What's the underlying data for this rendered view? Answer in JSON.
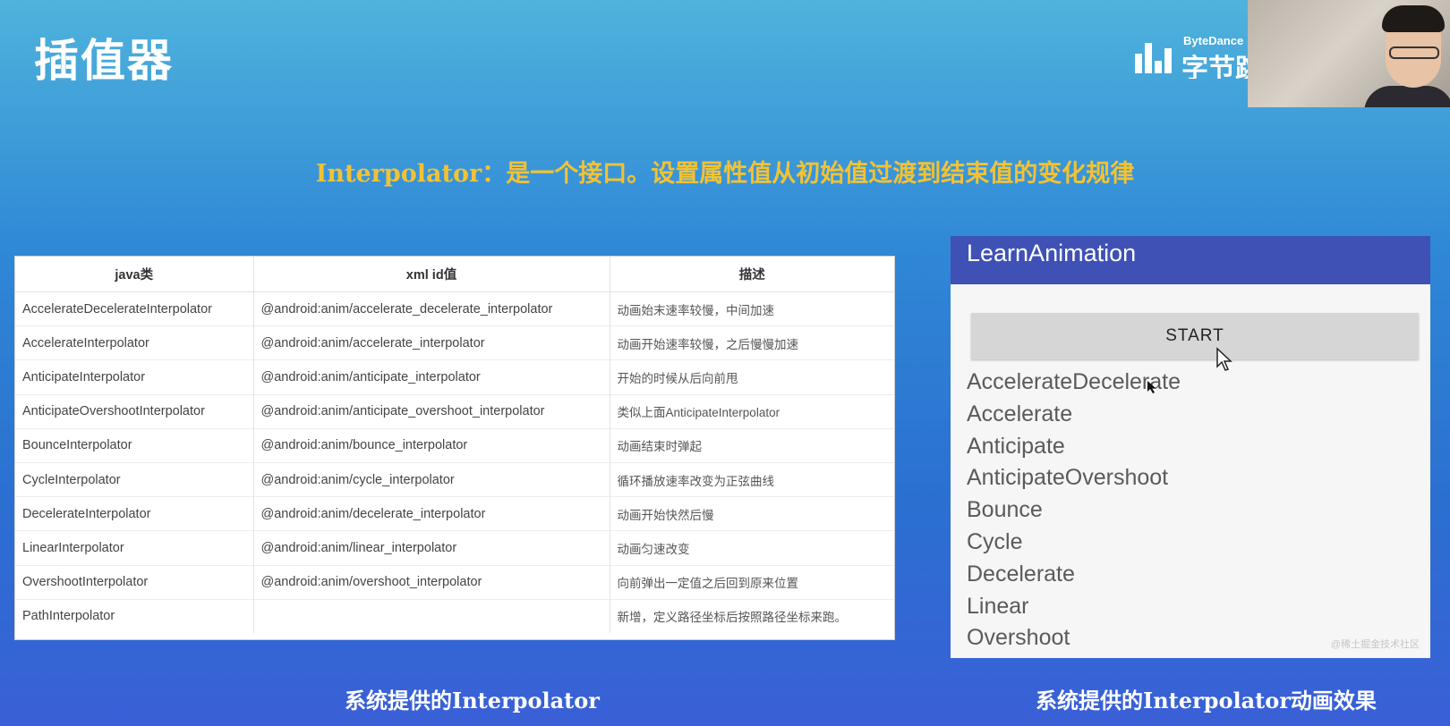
{
  "slide": {
    "title": "插值器",
    "headline": "Interpolator：是一个接口。设置属性值从初始值过渡到结束值的变化规律",
    "caption_left": "系统提供的Interpolator",
    "caption_right": "系统提供的Interpolator动画效果"
  },
  "logo": {
    "brand_small": "ByteDance",
    "brand_big": "字节跳",
    "icon": "bytedance-bars-icon"
  },
  "table": {
    "headers": [
      "java类",
      "xml id值",
      "描述"
    ],
    "rows": [
      {
        "cls": "AccelerateDecelerateInterpolator",
        "xml": "@android:anim/accelerate_decelerate_interpolator",
        "desc": "动画始末速率较慢，中间加速"
      },
      {
        "cls": "AccelerateInterpolator",
        "xml": "@android:anim/accelerate_interpolator",
        "desc": "动画开始速率较慢，之后慢慢加速"
      },
      {
        "cls": "AnticipateInterpolator",
        "xml": "@android:anim/anticipate_interpolator",
        "desc": "开始的时候从后向前甩"
      },
      {
        "cls": "AnticipateOvershootInterpolator",
        "xml": "@android:anim/anticipate_overshoot_interpolator",
        "desc": "类似上面AnticipateInterpolator"
      },
      {
        "cls": "BounceInterpolator",
        "xml": "@android:anim/bounce_interpolator",
        "desc": "动画结束时弹起"
      },
      {
        "cls": "CycleInterpolator",
        "xml": "@android:anim/cycle_interpolator",
        "desc": "循环播放速率改变为正弦曲线"
      },
      {
        "cls": "DecelerateInterpolator",
        "xml": "@android:anim/decelerate_interpolator",
        "desc": "动画开始快然后慢"
      },
      {
        "cls": "LinearInterpolator",
        "xml": "@android:anim/linear_interpolator",
        "desc": "动画匀速改变"
      },
      {
        "cls": "OvershootInterpolator",
        "xml": "@android:anim/overshoot_interpolator",
        "desc": "向前弹出一定值之后回到原来位置"
      },
      {
        "cls": "PathInterpolator",
        "xml": "",
        "desc": "新增，定义路径坐标后按照路径坐标来跑。"
      }
    ]
  },
  "app": {
    "title": "LearnAnimation",
    "start_label": "START",
    "items": [
      "AccelerateDecelerate",
      "Accelerate",
      "Anticipate",
      "AnticipateOvershoot",
      "Bounce",
      "Cycle",
      "Decelerate",
      "Linear",
      "Overshoot"
    ],
    "watermark": "@稀土掘金技术社区"
  },
  "colors": {
    "appbar": "#3f51b5",
    "headline": "#f2c234"
  }
}
